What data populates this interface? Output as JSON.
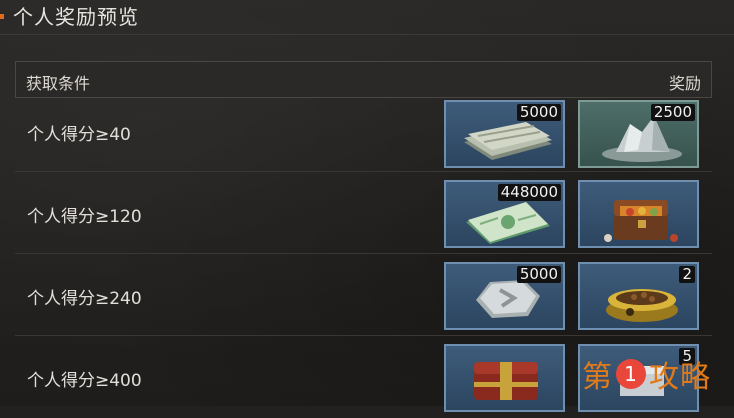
{
  "title": "个人奖励预览",
  "header": {
    "condition_label": "获取条件",
    "reward_label": "奖励"
  },
  "rows": [
    {
      "condition": "个人得分≥40",
      "rewards": [
        {
          "icon": "cash-stack-icon",
          "qty": "5000"
        },
        {
          "icon": "silver-ore-icon",
          "qty": "2500"
        }
      ]
    },
    {
      "condition": "个人得分≥120",
      "rewards": [
        {
          "icon": "green-ticket-icon",
          "qty": "448000"
        },
        {
          "icon": "food-chest-icon",
          "qty": ""
        }
      ]
    },
    {
      "condition": "个人得分≥240",
      "rewards": [
        {
          "icon": "silver-coin-icon",
          "qty": "5000"
        },
        {
          "icon": "pet-food-bowl-icon",
          "qty": "2"
        }
      ]
    },
    {
      "condition": "个人得分≥400",
      "rewards": [
        {
          "icon": "red-gift-chest-icon",
          "qty": ""
        },
        {
          "icon": "mystery-box-icon",
          "qty": "5"
        }
      ]
    }
  ],
  "watermark": {
    "left": "第",
    "badge": "1",
    "right": "攻略"
  },
  "colors": {
    "accent": "#e06a1e",
    "slot_blue": "#3e5c7a",
    "slot_green": "#4e6e69",
    "watermark": "#e07a1a"
  }
}
